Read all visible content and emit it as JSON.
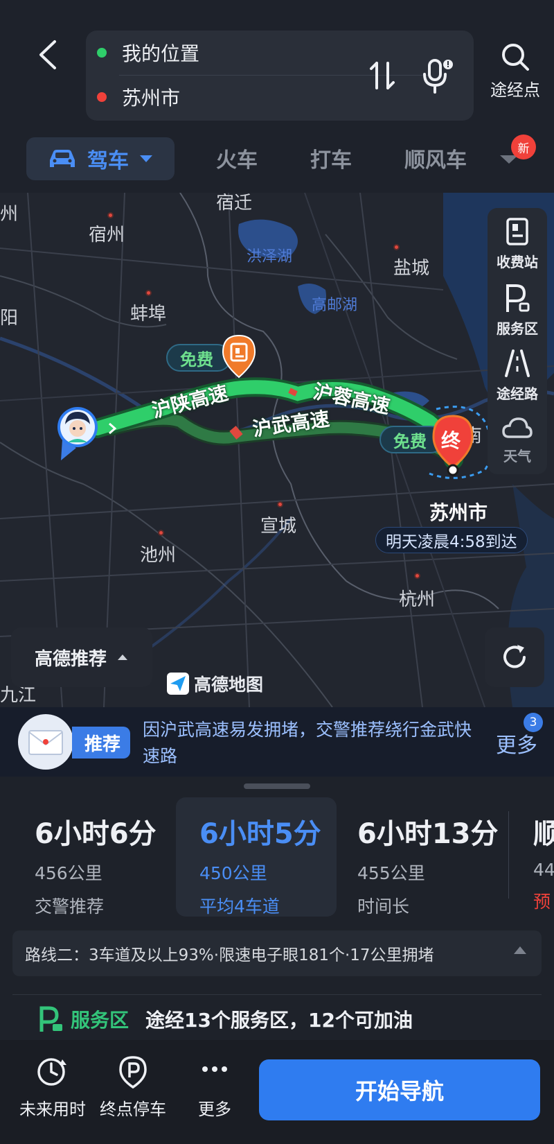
{
  "header": {
    "origin": "我的位置",
    "destination": "苏州市",
    "waypoint_label": "途经点"
  },
  "modes": {
    "drive": "驾车",
    "train": "火车",
    "taxi": "打车",
    "carpool": "顺风车",
    "new_badge": "新"
  },
  "map": {
    "cities": {
      "suqian": "宿迁",
      "suzhou_ah": "宿州",
      "yancheng": "盐城",
      "bengbu": "蚌埠",
      "xuancheng": "宣城",
      "chizhou": "池州",
      "hangzhou": "杭州",
      "nan": "南",
      "yang": "阳",
      "jiu": "九江",
      "left_edge": "州"
    },
    "lakes": {
      "hongze": "洪泽湖",
      "gaoyou": "高邮湖"
    },
    "roads": {
      "hushan": "沪陕高速",
      "hurong": "沪蓉高速",
      "huwu": "沪武高速"
    },
    "free_label_1": "免费",
    "free_label_2": "免费",
    "end_marker": "终",
    "dest_label": "苏州市",
    "arrival": "明天凌晨4:58到达",
    "logo": "高德地图",
    "recommend_btn": "高德推荐"
  },
  "side_tools": {
    "toll": "收费站",
    "service": "服务区",
    "via_road": "途经路",
    "weather": "天气"
  },
  "notice": {
    "tag": "推荐",
    "text": "因沪武高速易发拥堵，交警推荐绕行金武快速路",
    "more": "更多",
    "count": "3"
  },
  "routes": [
    {
      "time": "6小时6分",
      "distance": "456公里",
      "note": "交警推荐"
    },
    {
      "time": "6小时5分",
      "distance": "450公里",
      "note": "平均4车道"
    },
    {
      "time": "6小时13分",
      "distance": "455公里",
      "note": "时间长"
    },
    {
      "time": "顺",
      "distance": "44",
      "note": "预付"
    }
  ],
  "route_info": "路线二：3车道及以上93%·限速电子眼181个·17公里拥堵",
  "service_area": {
    "tag": "服务区",
    "text": "途经13个服务区，12个可加油"
  },
  "bottom": {
    "future_time": "未来用时",
    "parking": "终点停车",
    "more": "更多",
    "start": "开始导航"
  },
  "colors": {
    "accent_blue": "#2f7cf0",
    "route_green": "#2fce6a",
    "alt_route_green": "#2f7a45",
    "dest_red": "#f0413a",
    "toll_orange": "#f07a2a"
  }
}
